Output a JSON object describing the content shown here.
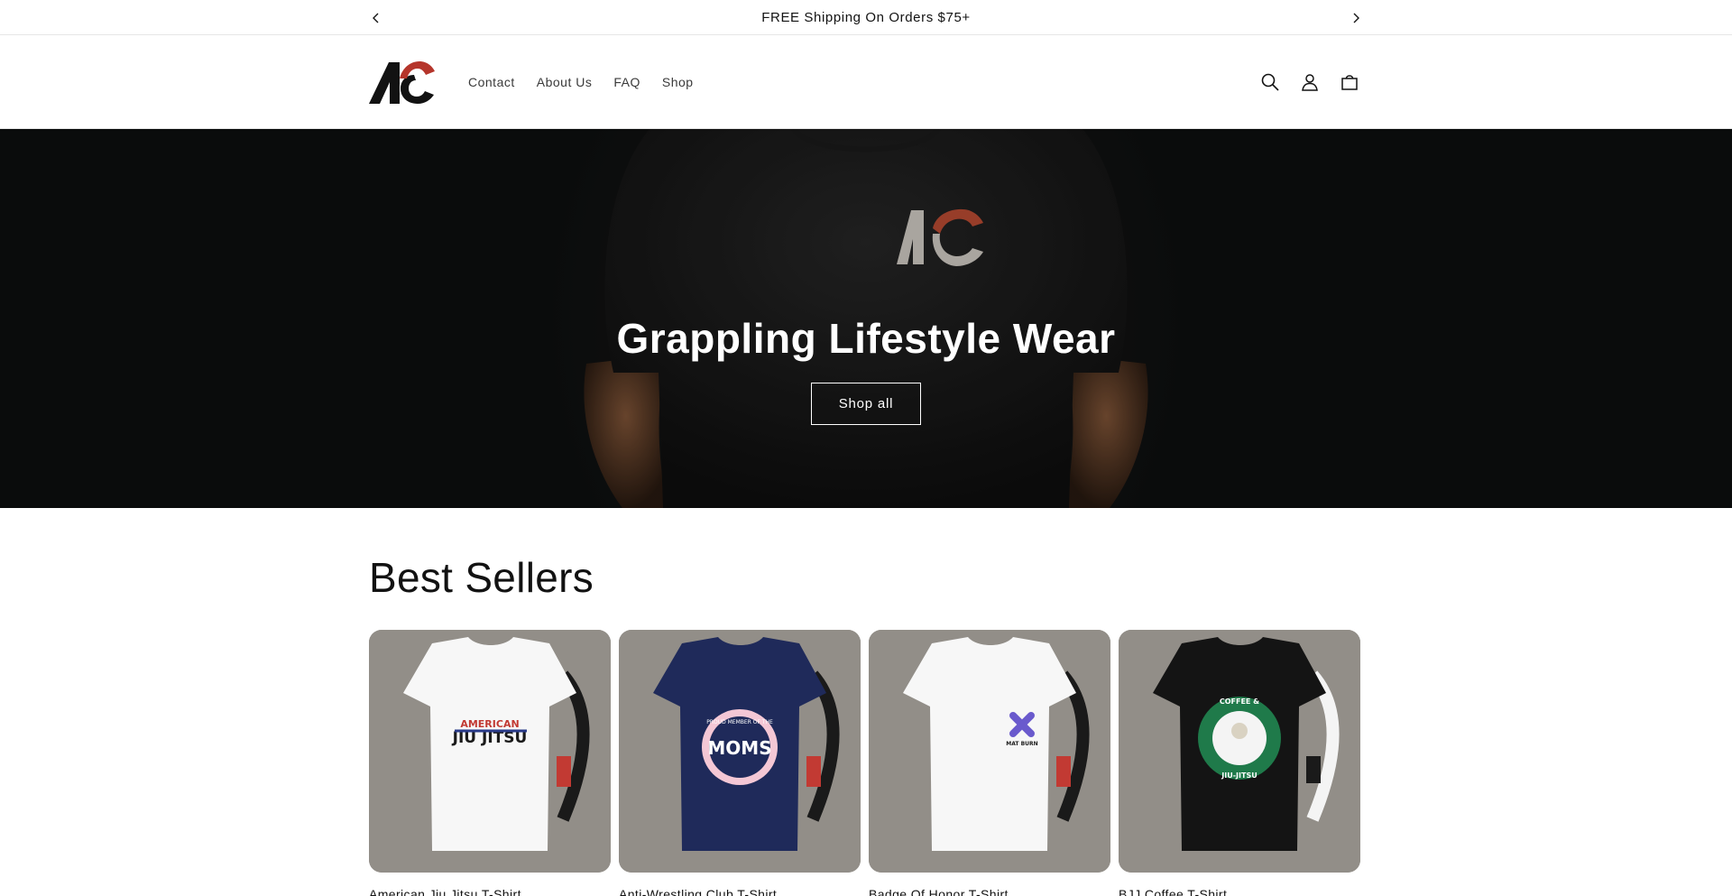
{
  "announcement": {
    "text": "FREE Shipping On Orders $75+"
  },
  "header": {
    "logo_text": "AC",
    "nav": [
      "Contact",
      "About Us",
      "FAQ",
      "Shop"
    ]
  },
  "hero": {
    "title": "Grappling Lifestyle Wear",
    "button_label": "Shop all",
    "shirt_logo_text": "AC"
  },
  "best_sellers": {
    "heading": "Best Sellers",
    "products": [
      {
        "title": "American Jiu Jitsu T-Shirt",
        "shirt_color": "#f7f7f7",
        "belt_color": "#1a1a1a",
        "graphic_text_top": "AMERICAN",
        "graphic_text_main": "JIU JITSU"
      },
      {
        "title": "Anti-Wrestling Club T-Shirt",
        "shirt_color": "#1f2a5a",
        "belt_color": "#1a1a1a",
        "graphic_text_top": "PROUD MEMBER OF THE",
        "graphic_text_main": "MOMS"
      },
      {
        "title": "Badge Of Honor T-Shirt",
        "shirt_color": "#f7f7f7",
        "belt_color": "#1a1a1a",
        "graphic_text_top": "",
        "graphic_text_main": "MAT BURN"
      },
      {
        "title": "BJJ Coffee T-Shirt",
        "shirt_color": "#141414",
        "belt_color": "#f4f4f4",
        "graphic_text_top": "COFFEE &",
        "graphic_text_main": "JIU-JITSU"
      }
    ]
  },
  "colors": {
    "brand_red": "#b5352b",
    "brand_black": "#121212"
  }
}
